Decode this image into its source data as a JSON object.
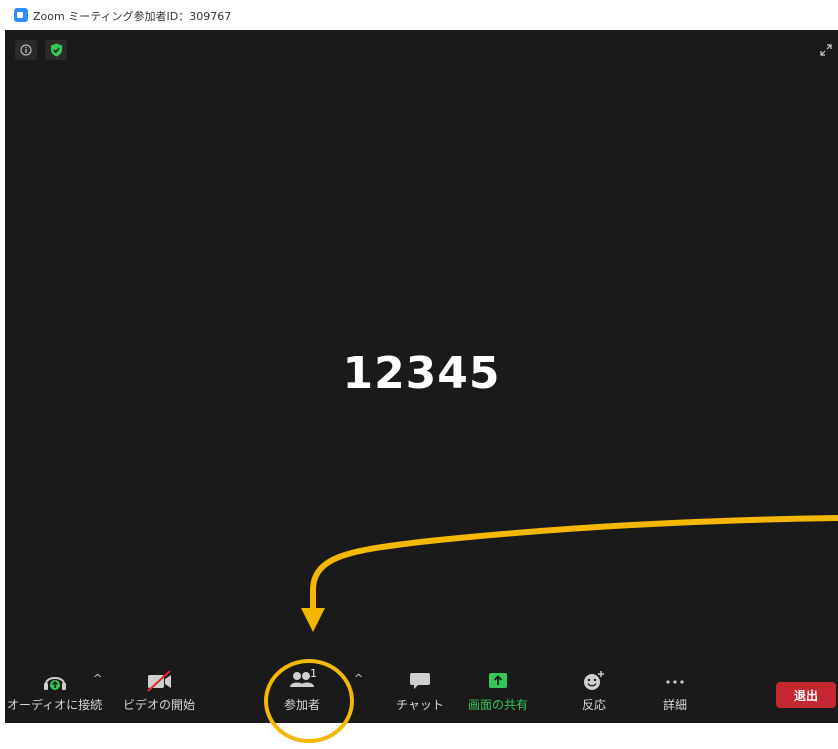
{
  "window": {
    "title": "Zoom ミーティング参加者ID：309767"
  },
  "meeting": {
    "center_text": "12345"
  },
  "toolbar": {
    "audio_label": "オーディオに接続",
    "video_label": "ビデオの開始",
    "participants_label": "参加者",
    "participants_count": "1",
    "chat_label": "チャット",
    "share_label": "画面の共有",
    "reactions_label": "反応",
    "more_label": "詳細",
    "leave_label": "退出"
  },
  "colors": {
    "background": "#1a1a1a",
    "share_green": "#34c759",
    "leave_red": "#c4272f",
    "annotation": "#f5b800",
    "zoom_blue": "#2d8cff"
  },
  "icons": {
    "title": "zoom-logo-icon",
    "info": "info-icon",
    "security": "shield-icon",
    "expand": "expand-icon",
    "audio": "headphone-icon",
    "video": "video-off-icon",
    "participants": "people-icon",
    "chat": "chat-bubble-icon",
    "share": "share-screen-icon",
    "reactions": "emoji-add-icon",
    "more": "ellipsis-icon"
  }
}
